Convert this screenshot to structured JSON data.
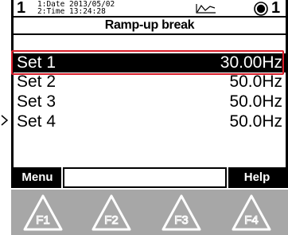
{
  "status": {
    "node_left": "1",
    "date_line": "1:Date 2013/05/02",
    "time_line": "2:Time 13:24:28",
    "node_right": "1",
    "icons": [
      "trend-icon",
      "record-icon"
    ]
  },
  "screen": {
    "title": "Ramp-up break",
    "rows": [
      {
        "label": "Set  1",
        "value": "30.00Hz",
        "selected": true
      },
      {
        "label": "Set  2",
        "value": "50.0Hz",
        "selected": false
      },
      {
        "label": "Set  3",
        "value": "50.0Hz",
        "selected": false
      },
      {
        "label": "Set  4",
        "value": "50.0Hz",
        "selected": false
      }
    ]
  },
  "softkeys": {
    "left": "Menu",
    "middle": "",
    "right": "Help"
  },
  "function_keys": [
    "F1",
    "F2",
    "F3",
    "F4"
  ],
  "colors": {
    "highlight": "#d81e2a",
    "panel": "#a7a7a7",
    "lcd_fg": "#000000",
    "lcd_bg": "#ffffff"
  }
}
